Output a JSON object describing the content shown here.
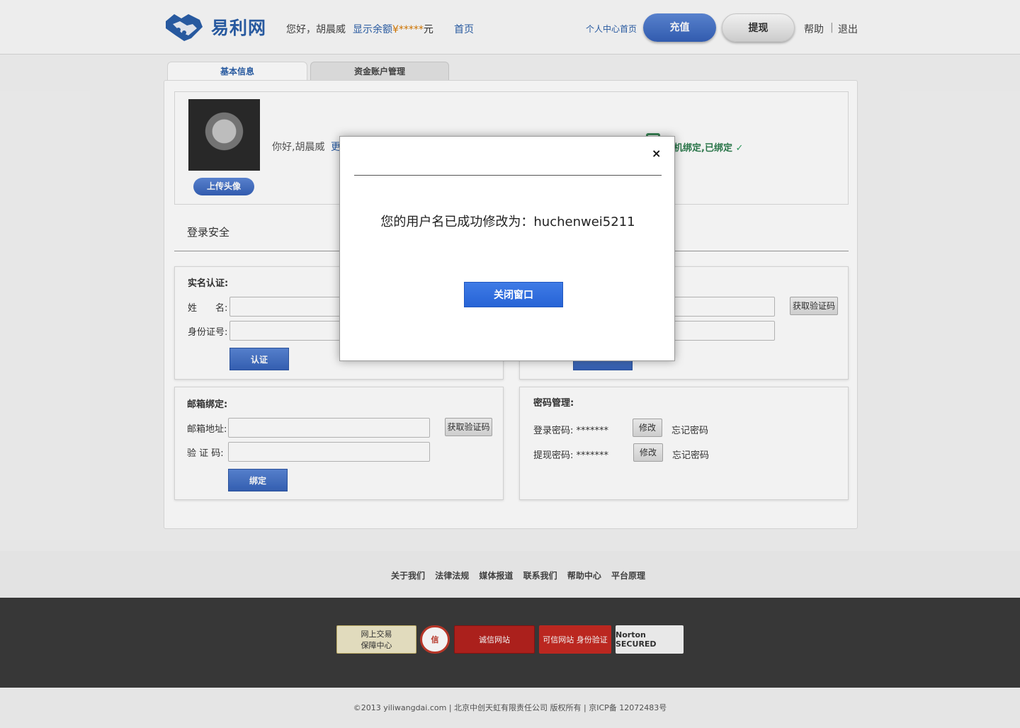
{
  "header": {
    "logo_text": "易利网",
    "greeting": "您好，胡晨威",
    "balance_label": "显示余额",
    "balance_amount": "¥*****",
    "balance_unit": "元",
    "home": "首页",
    "user_center": "个人中心首页",
    "recharge": "充值",
    "withdraw": "提现",
    "help": "帮助",
    "separator": "|",
    "logout": "退出"
  },
  "tabs": [
    "基本信息",
    "资金账户管理"
  ],
  "profile": {
    "upload_avatar": "上传头像",
    "hello": "你好,胡晨威",
    "change_link": "更",
    "phone_bound": "手机绑定,已绑定",
    "check": "✓"
  },
  "security": {
    "title": "登录安全"
  },
  "real_name": {
    "title": "实名认证:",
    "name_label": "姓　　名:",
    "id_label": "身份证号:",
    "submit": "认证"
  },
  "phone": {
    "get_code": "获取验证码"
  },
  "email": {
    "title": "邮箱绑定:",
    "address_label": "邮箱地址:",
    "code_label": "验 证 码:",
    "get_code": "获取验证码",
    "submit": "绑定"
  },
  "password": {
    "title": "密码管理:",
    "login_label": "登录密码: *******",
    "withdraw_label": "提现密码: *******",
    "modify": "修改",
    "forgot": "忘记密码"
  },
  "footer": {
    "links": [
      "关于我们",
      "法律法规",
      "媒体报道",
      "联系我们",
      "帮助中心",
      "平台原理"
    ],
    "badges": [
      "网上交易\n保障中心",
      "信",
      "诚信网站",
      "可信网站 身份验证",
      "Norton SECURED"
    ],
    "copyright": "©2013 yiliwangdai.com | 北京中创天虹有限责任公司 版权所有 | 京ICP备 12072483号"
  },
  "modal": {
    "close": "×",
    "message": "您的用户名已成功修改为：huchenwei5211",
    "button": "关闭窗口"
  },
  "colors": {
    "brand": "#2a5ea8",
    "button_blue": "#2663d6"
  }
}
